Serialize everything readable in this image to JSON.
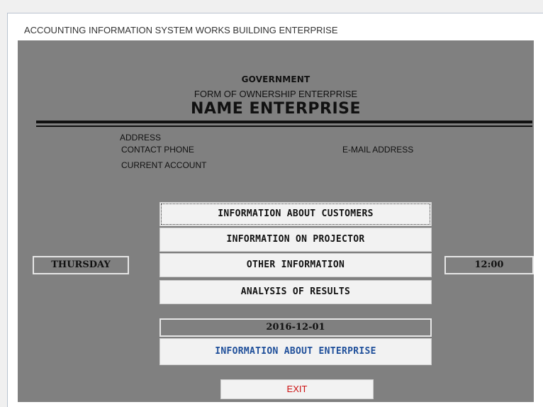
{
  "window": {
    "title": "ACCOUNTING INFORMATION SYSTEM WORKS BUILDING ENTERPRISE"
  },
  "header": {
    "government": "GOVERNMENT",
    "form_of_ownership": "FORM OF OWNERSHIP ENTERPRISE",
    "name_enterprise": "NAME ENTERPRISE"
  },
  "details": {
    "address": "ADDRESS",
    "contact_phone": "CONTACT PHONE",
    "current_account": "CURRENT ACCOUNT",
    "email_address": "E-MAIL ADDRESS"
  },
  "status": {
    "day": "THURSDAY",
    "time": "12:00",
    "date": "2016-12-01"
  },
  "menu": {
    "customers": "INFORMATION ABOUT CUSTOMERS",
    "projector": "INFORMATION ON PROJECTOR",
    "other": "OTHER INFORMATION",
    "analysis": "ANALYSIS OF RESULTS",
    "enterprise": "INFORMATION ABOUT ENTERPRISE",
    "exit": "EXIT"
  },
  "colors": {
    "panel_background": "#808080",
    "enterprise_text": "#1f4f9a",
    "exit_text": "#cc1111"
  }
}
